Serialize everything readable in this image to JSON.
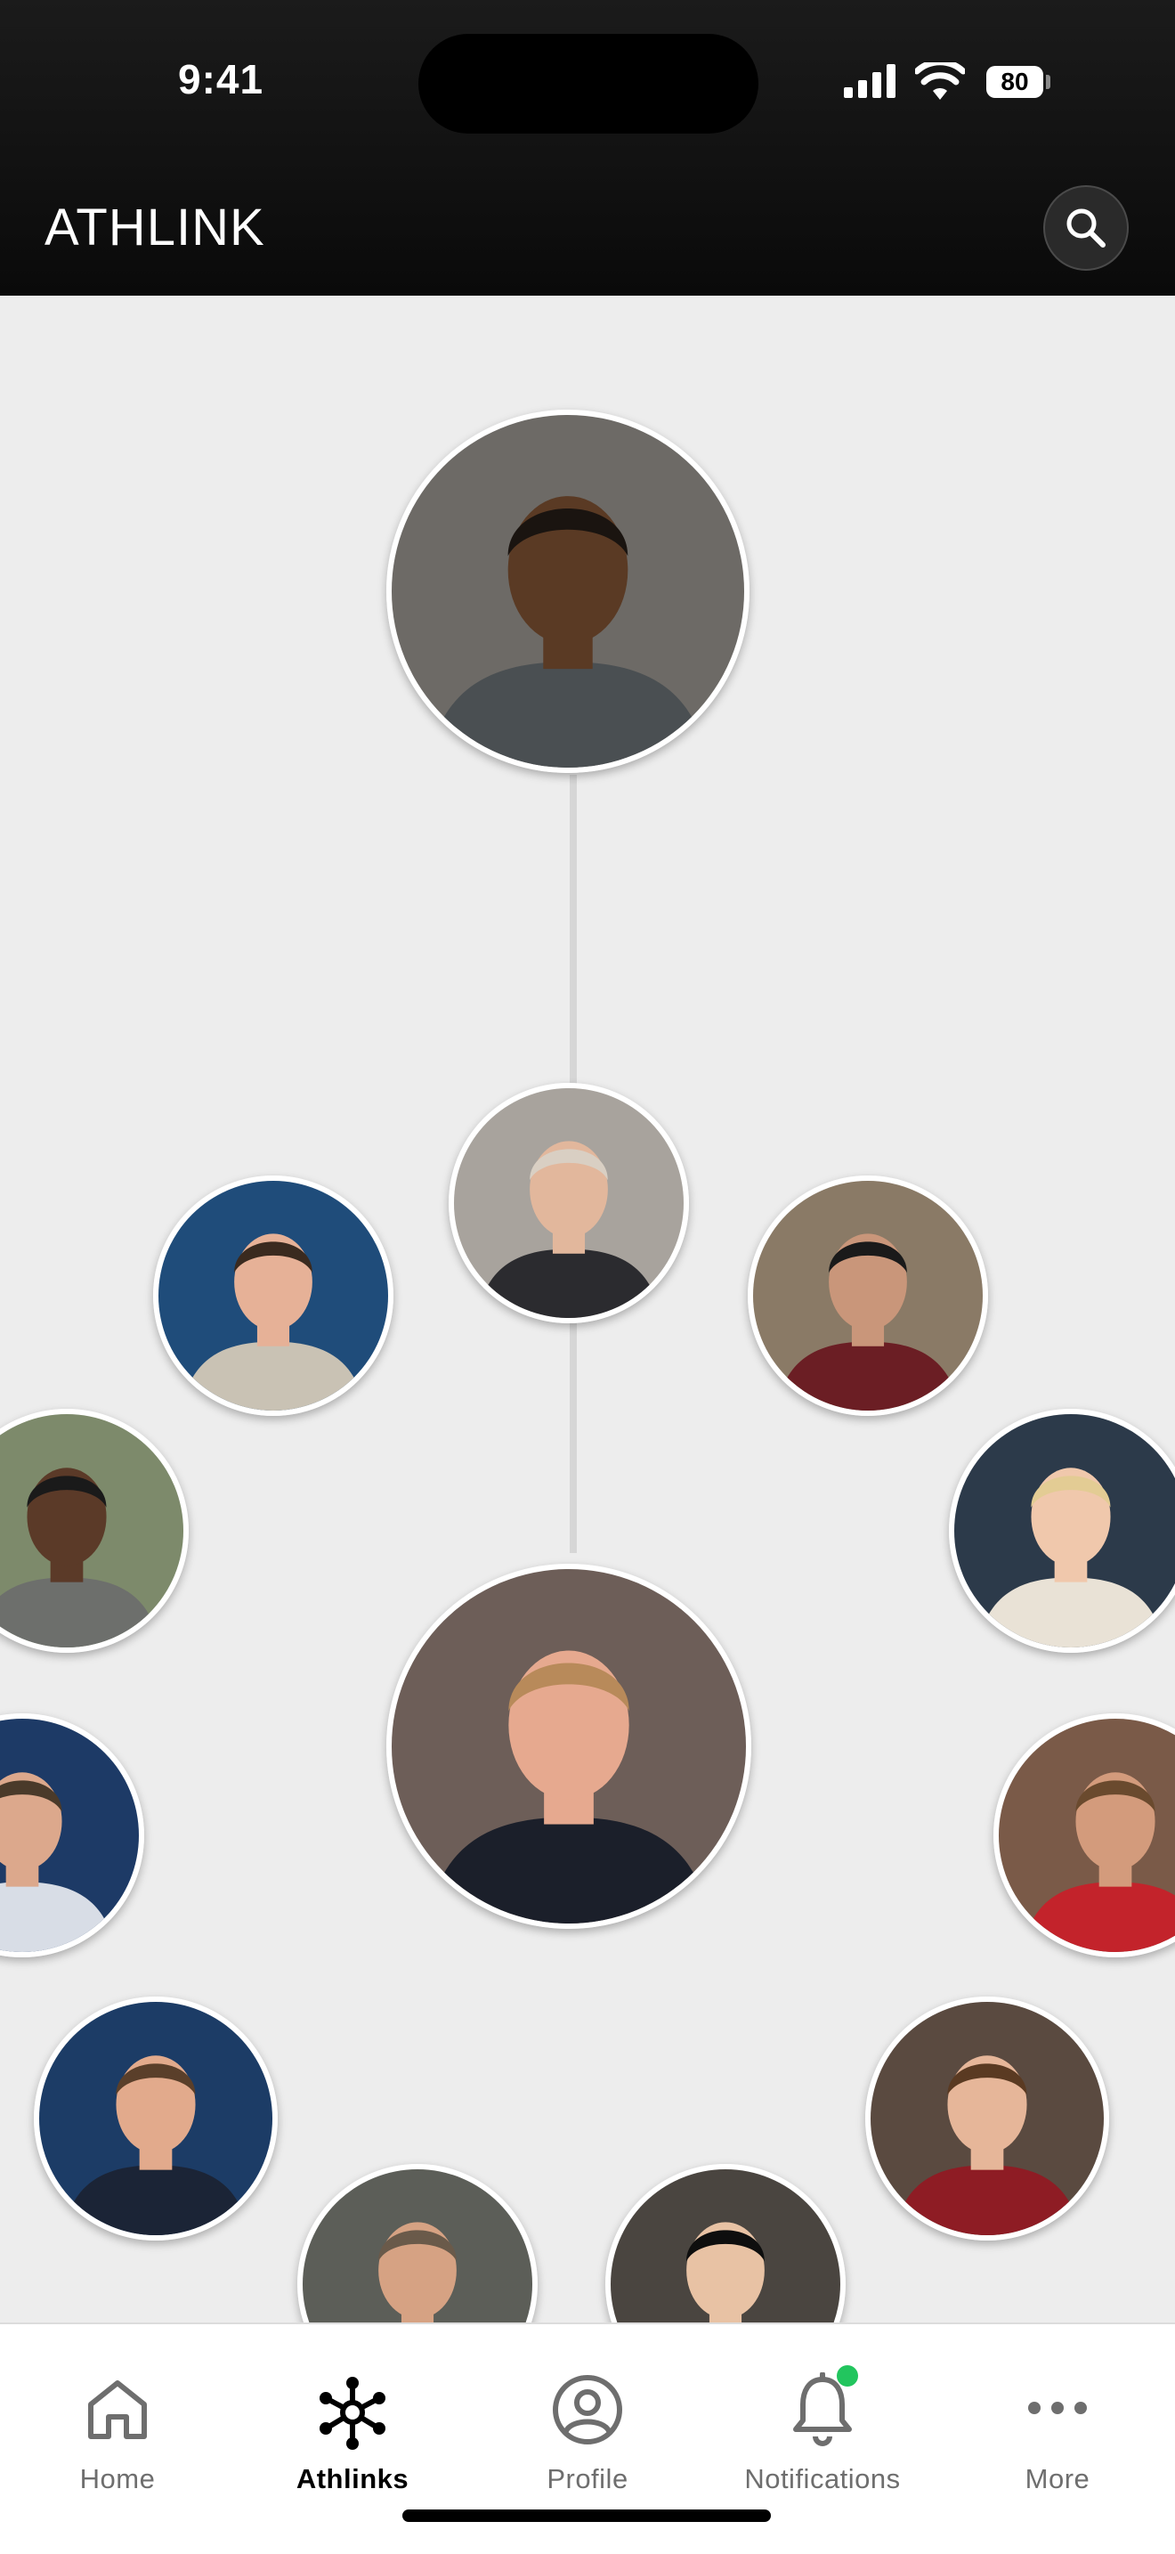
{
  "status_bar": {
    "time": "9:41",
    "battery": "80"
  },
  "header": {
    "app_title": "ATHLINK"
  },
  "network": {
    "nodes": [
      {
        "id": "athlete-main",
        "bg": "#6d6a66",
        "skin": "#5a3a24",
        "shirt": "#4a4f52",
        "hair": "#1a1410"
      },
      {
        "id": "coach-center",
        "bg": "#a8a39d",
        "skin": "#e2b79c",
        "shirt": "#2b2b2f",
        "hair": "#d9cfc3"
      },
      {
        "id": "coach-left",
        "bg": "#1f4c7a",
        "skin": "#e6b197",
        "shirt": "#c9c2b4",
        "hair": "#3a2a1f"
      },
      {
        "id": "coach-right",
        "bg": "#8a7a66",
        "skin": "#c9967a",
        "shirt": "#6b1e24",
        "hair": "#1a1a1a"
      },
      {
        "id": "coach-far-left",
        "bg": "#7d8a6b",
        "skin": "#5b3a28",
        "shirt": "#6d6f6c",
        "hair": "#1a1a1a"
      },
      {
        "id": "coach-far-right",
        "bg": "#2c3a4a",
        "skin": "#f0c8ac",
        "shirt": "#e9e2d6",
        "hair": "#e3cc94"
      },
      {
        "id": "coach-featured",
        "bg": "#6d5e58",
        "skin": "#e6a98f",
        "shirt": "#1b1f2a",
        "hair": "#b88a5a"
      },
      {
        "id": "coach-edge-left",
        "bg": "#1d3a66",
        "skin": "#dca88c",
        "shirt": "#d8dde6",
        "hair": "#4a3a2a"
      },
      {
        "id": "coach-edge-right",
        "bg": "#7a5a48",
        "skin": "#d39b7c",
        "shirt": "#c3232b",
        "hair": "#6a4a2e"
      },
      {
        "id": "coach-low-left",
        "bg": "#1c3c66",
        "skin": "#e2aa8c",
        "shirt": "#1b2436",
        "hair": "#5a3f2a"
      },
      {
        "id": "athlete-low-right",
        "bg": "#5a4a40",
        "skin": "#e6b699",
        "shirt": "#8e1c24",
        "hair": "#5a3a22"
      },
      {
        "id": "coach-bottom-left",
        "bg": "#5c5e58",
        "skin": "#d6a283",
        "shirt": "#2d3342",
        "hair": "#6a5a4a"
      },
      {
        "id": "person-bottom-right",
        "bg": "#4a4540",
        "skin": "#e8c2a4",
        "shirt": "#1b1b1b",
        "hair": "#0e0e0e"
      }
    ]
  },
  "tabbar": {
    "tabs": [
      {
        "label": "Home"
      },
      {
        "label": "Athlinks"
      },
      {
        "label": "Profile"
      },
      {
        "label": "Notifications"
      },
      {
        "label": "More"
      }
    ],
    "active_color": "#000000",
    "inactive_color": "#6e6e6e",
    "notification_dot_color": "#22c55e"
  }
}
